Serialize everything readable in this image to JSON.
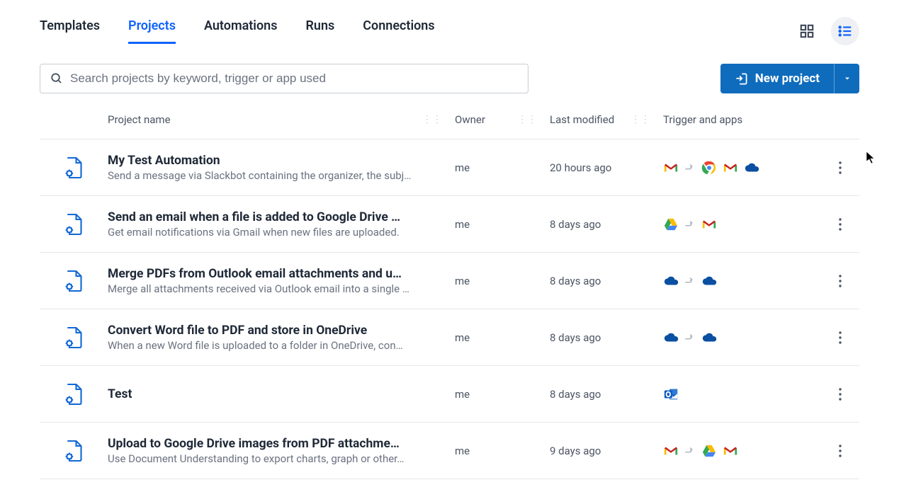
{
  "tabs": [
    "Templates",
    "Projects",
    "Automations",
    "Runs",
    "Connections"
  ],
  "active_tab_index": 1,
  "search": {
    "placeholder": "Search projects by keyword, trigger or app used"
  },
  "new_project_label": "New project",
  "columns": {
    "name": "Project name",
    "owner": "Owner",
    "modified": "Last modified",
    "trigger": "Trigger and apps"
  },
  "rows": [
    {
      "title": "My Test Automation",
      "desc": "Send a message via Slackbot containing the organizer, the subj…",
      "owner": "me",
      "modified": "20 hours ago",
      "apps": [
        "gmail",
        "arrow",
        "chrome",
        "gmail",
        "onedrive"
      ]
    },
    {
      "title": "Send an email when a file is added to Google Drive …",
      "desc": "Get email notifications via Gmail when new files are uploaded.",
      "owner": "me",
      "modified": "8 days ago",
      "apps": [
        "gdrive",
        "arrow",
        "gmail"
      ]
    },
    {
      "title": "Merge PDFs from Outlook email attachments and u…",
      "desc": "Merge all attachments received via Outlook email into a single …",
      "owner": "me",
      "modified": "8 days ago",
      "apps": [
        "onedrive",
        "arrow",
        "onedrive"
      ]
    },
    {
      "title": "Convert Word file to PDF and store in OneDrive",
      "desc": "When a new Word file is uploaded to a folder in OneDrive, con…",
      "owner": "me",
      "modified": "8 days ago",
      "apps": [
        "onedrive",
        "arrow",
        "onedrive"
      ]
    },
    {
      "title": "Test",
      "desc": "",
      "owner": "me",
      "modified": "8 days ago",
      "apps": [
        "outlook"
      ]
    },
    {
      "title": "Upload to Google Drive images from PDF attachme…",
      "desc": "Use Document Understanding to export charts, graph or other…",
      "owner": "me",
      "modified": "9 days ago",
      "apps": [
        "gmail",
        "arrow",
        "gdrive",
        "gmail"
      ]
    }
  ]
}
